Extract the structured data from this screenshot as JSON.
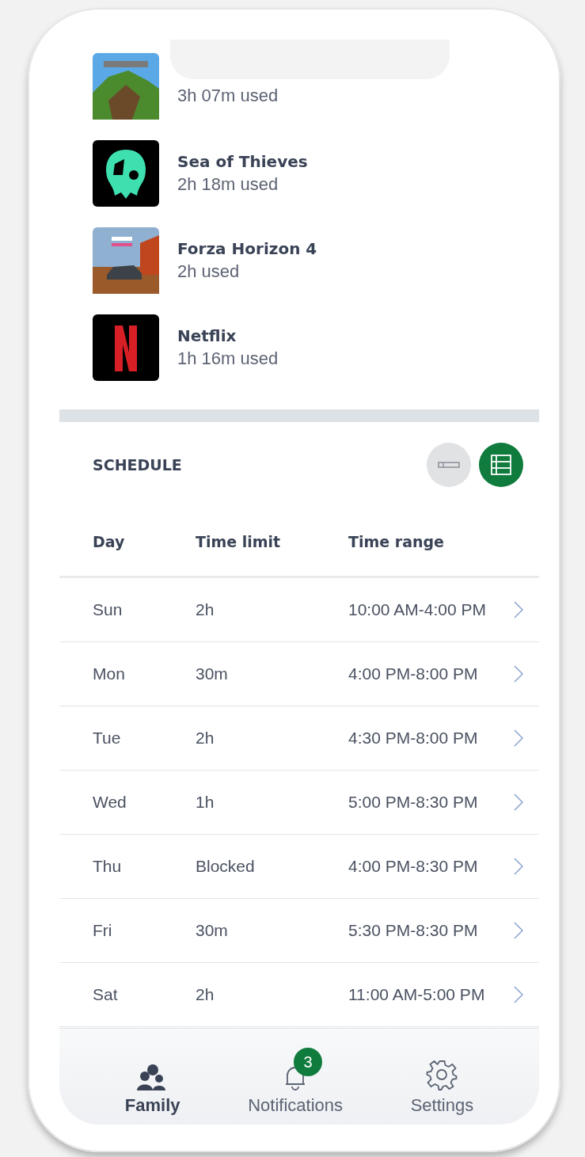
{
  "games": [
    {
      "kind": "minecraft",
      "usage": "3h 07m used"
    },
    {
      "kind": "sea-of-thieves",
      "name": "Sea of Thieves",
      "usage": "2h 18m used"
    },
    {
      "kind": "forza",
      "name": "Forza Horizon 4",
      "usage": "2h used"
    },
    {
      "kind": "netflix",
      "name": "Netflix",
      "usage": "1h 16m used"
    }
  ],
  "schedule": {
    "title": "SCHEDULE",
    "views": [
      {
        "kind": "compact",
        "selected": false
      },
      {
        "kind": "table",
        "selected": true
      }
    ],
    "columns": [
      "Day",
      "Time limit",
      "Time range"
    ],
    "rows": [
      {
        "day": "Sun",
        "limit": "2h",
        "range": "10:00 AM-4:00 PM"
      },
      {
        "day": "Mon",
        "limit": "30m",
        "range": "4:00 PM-8:00 PM"
      },
      {
        "day": "Tue",
        "limit": "2h",
        "range": "4:30 PM-8:00 PM"
      },
      {
        "day": "Wed",
        "limit": "1h",
        "range": "5:00 PM-8:30 PM"
      },
      {
        "day": "Thu",
        "limit": "Blocked",
        "range": "4:00 PM-8:30 PM"
      },
      {
        "day": "Fri",
        "limit": "30m",
        "range": "5:30 PM-8:30 PM"
      },
      {
        "day": "Sat",
        "limit": "2h",
        "range": "11:00 AM-5:00 PM"
      }
    ]
  },
  "nav": [
    {
      "kind": "family",
      "label": "Family",
      "selected": true
    },
    {
      "kind": "notifications",
      "label": "Notifications",
      "selected": false,
      "badge": "3"
    },
    {
      "kind": "settings",
      "label": "Settings",
      "selected": false
    }
  ]
}
